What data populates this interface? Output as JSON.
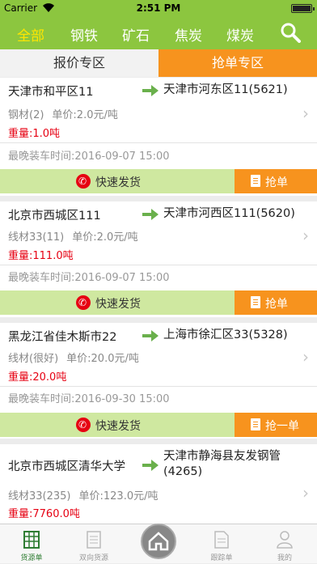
{
  "status_bar": {
    "carrier": "Carrier",
    "time": "2:51 PM"
  },
  "nav": {
    "tabs": [
      {
        "label": "全部",
        "active": true
      },
      {
        "label": "钢铁",
        "active": false
      },
      {
        "label": "矿石",
        "active": false
      },
      {
        "label": "焦炭",
        "active": false
      },
      {
        "label": "煤炭",
        "active": false
      }
    ],
    "accent": "#8cc63f",
    "active_color": "#ffe600"
  },
  "subtabs": {
    "quote": "报价专区",
    "grab": "抢单专区",
    "grab_color": "#f7931e"
  },
  "orders": [
    {
      "from": "天津市和平区11",
      "to": "天津市河东区11(5621)",
      "material": "钢材(2)",
      "price": "单价:2.0元/吨",
      "weight": "重量:1.0吨",
      "date": "最晚装车时间:2016-09-07 15:00",
      "quick": "快速发货",
      "grab": "抢单"
    },
    {
      "from": "北京市西城区111",
      "to": "天津市河西区111(5620)",
      "material": "线材33(11)",
      "price": "单价:2.0元/吨",
      "weight": "重量:111.0吨",
      "date": "最晚装车时间:2016-09-07 15:00",
      "quick": "快速发货",
      "grab": "抢单"
    },
    {
      "from": "黑龙江省佳木斯市22",
      "to": "上海市徐汇区33(5328)",
      "material": "线材(很好)",
      "price": "单价:20.0元/吨",
      "weight": "重量:20.0吨",
      "date": "最晚装车时间:2016-09-30 15:00",
      "quick": "快速发货",
      "grab": "抢一单"
    },
    {
      "from": "北京市西城区清华大学",
      "to": "天津市静海县友发钢管(4265)",
      "material": "线材33(235)",
      "price": "单价:123.0元/吨",
      "weight": "重量:7760.0吨"
    }
  ],
  "tabbar": [
    {
      "label": "货源单",
      "active": true
    },
    {
      "label": "双向货源",
      "active": false
    },
    {
      "label": "",
      "active": false
    },
    {
      "label": "跟踪单",
      "active": false
    },
    {
      "label": "我的",
      "active": false
    }
  ]
}
